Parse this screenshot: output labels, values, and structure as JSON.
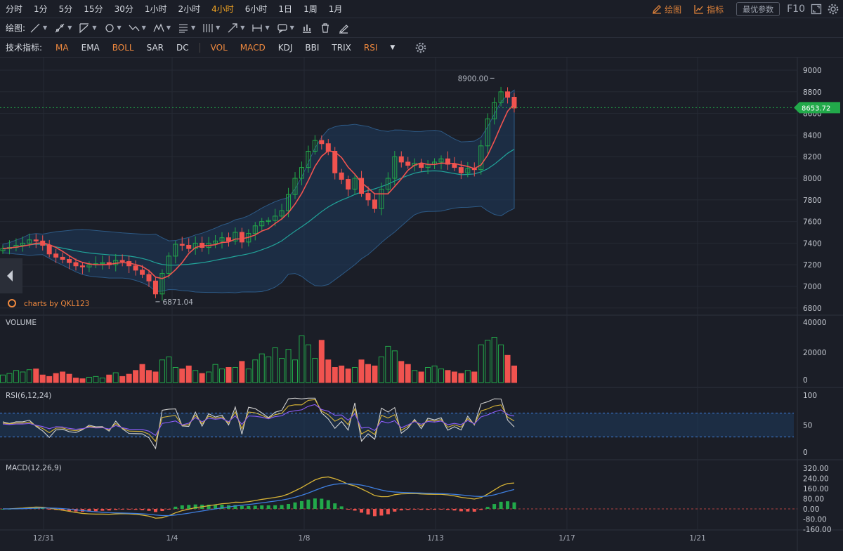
{
  "timeframes": [
    "分时",
    "1分",
    "5分",
    "15分",
    "30分",
    "1小时",
    "2小时",
    "4小时",
    "6小时",
    "1日",
    "1周",
    "1月"
  ],
  "active_timeframe": "4小时",
  "toolbar": {
    "draw_label": "绘图",
    "indicator_label": "指标",
    "params_label": "最优参数",
    "f10_label": "F10"
  },
  "drawing": {
    "label": "绘图:"
  },
  "indicators": {
    "label": "技术指标:",
    "main": [
      {
        "name": "MA",
        "on": true
      },
      {
        "name": "EMA",
        "on": false
      },
      {
        "name": "BOLL",
        "on": true
      },
      {
        "name": "SAR",
        "on": false
      },
      {
        "name": "DC",
        "on": false
      }
    ],
    "sub": [
      {
        "name": "VOL",
        "on": true
      },
      {
        "name": "MACD",
        "on": true
      },
      {
        "name": "KDJ",
        "on": false
      },
      {
        "name": "BBI",
        "on": false
      },
      {
        "name": "TRIX",
        "on": false
      },
      {
        "name": "RSI",
        "on": true
      }
    ]
  },
  "colors": {
    "up": "#22a94a",
    "down": "#f0534f",
    "ma": "#f0534f",
    "boll_mid": "#21a49a",
    "boll_band": "#1d3a5c",
    "rsi1": "#d0d0d0",
    "rsi2": "#d8b436",
    "rsi3": "#8b5cf6",
    "macd_dif": "#d8b436",
    "macd_dea": "#3f7fe0",
    "accent": "#f0893e"
  },
  "price_axis": {
    "ticks": [
      "9000",
      "8800",
      "8600",
      "8400",
      "8200",
      "8000",
      "7800",
      "7600",
      "7400",
      "7200",
      "7000",
      "6800"
    ],
    "current": "8653.72",
    "high_label": "8900.00",
    "low_label": "6871.04"
  },
  "watermark": "charts by QKL123",
  "x_axis": {
    "labels": [
      "12/31",
      "1/4",
      "1/8",
      "1/13",
      "1/17",
      "1/21"
    ]
  },
  "volume": {
    "title": "VOLUME",
    "ticks": [
      "40000",
      "20000",
      "0"
    ]
  },
  "rsi": {
    "title": "RSI(6,12,24)",
    "ticks": [
      "100",
      "50",
      "0"
    ]
  },
  "macd": {
    "title": "MACD(12,26,9)",
    "ticks": [
      "320.00",
      "240.00",
      "160.00",
      "80.00",
      "0.00",
      "-80.00",
      "-160.00"
    ]
  },
  "chart_data": {
    "type": "candlestick",
    "closes": [
      7350,
      7360,
      7380,
      7400,
      7430,
      7420,
      7380,
      7300,
      7270,
      7250,
      7220,
      7190,
      7180,
      7200,
      7210,
      7220,
      7200,
      7240,
      7230,
      7190,
      7150,
      7110,
      7050,
      6930,
      7120,
      7280,
      7390,
      7380,
      7350,
      7400,
      7360,
      7400,
      7420,
      7450,
      7420,
      7500,
      7410,
      7490,
      7560,
      7600,
      7610,
      7650,
      7700,
      7850,
      8000,
      8100,
      8250,
      8350,
      8320,
      8250,
      8050,
      7990,
      7900,
      8000,
      7860,
      7800,
      7720,
      7900,
      8000,
      8200,
      8150,
      8120,
      8140,
      8100,
      8130,
      8150,
      8180,
      8130,
      8100,
      8050,
      8090,
      8080,
      8300,
      8550,
      8700,
      8800,
      8750,
      8650
    ],
    "volumes": [
      5000,
      6000,
      8000,
      7000,
      8500,
      9000,
      5000,
      4000,
      6000,
      7000,
      5500,
      3000,
      2500,
      3500,
      4000,
      3000,
      5000,
      6500,
      4000,
      5500,
      8000,
      12000,
      8000,
      7000,
      15000,
      17000,
      10000,
      9000,
      11000,
      8000,
      6000,
      7000,
      12000,
      9000,
      10000,
      10000,
      14000,
      9000,
      15000,
      19000,
      17000,
      23000,
      16000,
      22000,
      15000,
      31000,
      25000,
      16000,
      28000,
      15000,
      10000,
      11000,
      9000,
      10000,
      15000,
      12000,
      11000,
      17000,
      24000,
      21000,
      14000,
      12000,
      8000,
      7000,
      10000,
      11000,
      9000,
      8000,
      7000,
      6000,
      8000,
      7000,
      25000,
      28000,
      30000,
      25000,
      18000,
      11000
    ]
  }
}
